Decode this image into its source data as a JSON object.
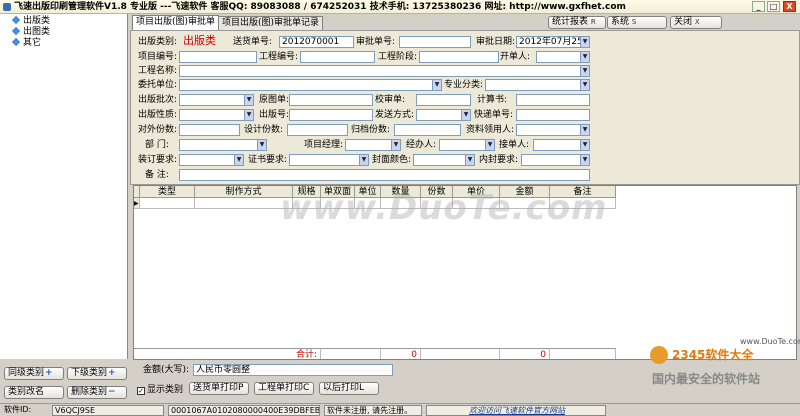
{
  "titlebar": {
    "title": "飞速出版印刷管理软件V1.8  专业版  ---飞速软件  客服QQ: 89083088 / 674252031  技术手机: 13725380236  网址: http://www.gxfhet.com",
    "min": "_",
    "max": "□",
    "close": "X"
  },
  "tree": {
    "items": [
      "出版类",
      "出图类",
      "其它"
    ]
  },
  "sidebar_buttons": {
    "parent": "同级类别",
    "child": "下级类别",
    "rename": "类别改名",
    "delete": "删除类别"
  },
  "tabs": [
    "项目出版(图)审批单",
    "项目出版(图)审批单记录"
  ],
  "toolbar": {
    "stats": "统计报表",
    "stats_key": "R",
    "system": "系统",
    "system_key": "S",
    "close": "关闭",
    "close_key": "X"
  },
  "form": {
    "type_label": "出版类别:",
    "type_value": "出版类",
    "send_no_label": "送货单号:",
    "send_no_value": "2012070001",
    "approve_no_label": "审批单号:",
    "approve_no_value": "",
    "approve_date_label": "审批日期:",
    "approve_date_value": "2012年07月25日",
    "project_no_label": "项目编号:",
    "engineering_no_label": "工程编号:",
    "stage_label": "工程阶段:",
    "opener_label": "开单人:",
    "engineering_name_label": "工程名称:",
    "client_label": "委托单位:",
    "specialty_label": "专业分类:",
    "batch_label": "出版批次:",
    "original_label": "原图单:",
    "proof_label": "校审单:",
    "calc_label": "计算书:",
    "nature_label": "出版性质:",
    "version_label": "出版号:",
    "send_method_label": "发送方式:",
    "express_label": "快递单号:",
    "external_copies_label": "对外份数:",
    "design_copies_label": "设计份数:",
    "archive_copies_label": "归档份数:",
    "receiver_label": "资料领用人:",
    "dept_label": "部   门:",
    "manager_label": "项目经理:",
    "handler_label": "经办人:",
    "recipient_label": "接单人:",
    "binding_label": "装订要求:",
    "cert_label": "证书要求:",
    "cover_color_label": "封面颜色:",
    "inner_label": "内封要求:",
    "remark_label": "备   注:"
  },
  "grid": {
    "headers": [
      "类型",
      "制作方式",
      "规格",
      "单双面",
      "单位",
      "数量",
      "份数",
      "单价",
      "金额",
      "备注"
    ],
    "total_label": "合计:",
    "total_qty": "0",
    "total_amount": "0"
  },
  "bottom": {
    "amount_label": "金额(大写):",
    "amount_value": "人民币零圆整",
    "show_category": "显示类别",
    "print_send": "送货单打印P",
    "print_project": "工程单打印C",
    "print_later": "以后打印L"
  },
  "status": {
    "software_id_label": "软件ID:",
    "software_id": "V6QCJ9SE",
    "machine_code": "0001067A0102080000400E39DBFEBFBFF",
    "register": "软件未注册, 请先注册。",
    "visit": "欢迎访问飞速软件官方网站"
  },
  "watermark": {
    "main": "www.DuoTe.com",
    "badge": "2345软件大全",
    "badge_sub": "国内最安全的软件站",
    "badge_url": "www.DuoTe.com"
  },
  "colors": {
    "accent": "#1a3a8a",
    "red": "#cc0000"
  }
}
